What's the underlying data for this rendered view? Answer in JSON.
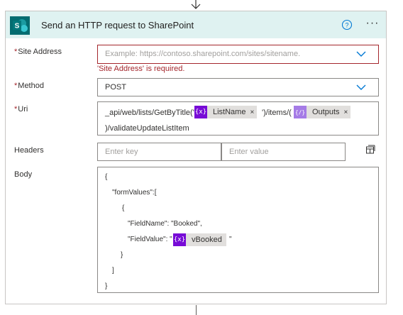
{
  "card": {
    "title": "Send an HTTP request to SharePoint",
    "help_icon": "question-circle-icon",
    "more_icon": "ellipsis-icon",
    "more_label": "···",
    "logo_letter": "S",
    "header_bg": "#dff2f1",
    "logo_color": "#038387"
  },
  "fields": {
    "required_mark": "*",
    "site_address": {
      "label": "Site Address",
      "placeholder": "Example: https://contoso.sharepoint.com/sites/sitename.",
      "error": "'Site Address' is required."
    },
    "method": {
      "label": "Method",
      "value": "POST"
    },
    "uri": {
      "label": "Uri",
      "text1": "_api/web/lists/GetByTitle('",
      "token1": "ListName",
      "text2": "')/items/(",
      "token2": "Outputs",
      "text3": ")/validateUpdateListItem"
    },
    "headers": {
      "label": "Headers",
      "key_placeholder": "Enter key",
      "value_placeholder": "Enter value"
    },
    "body": {
      "label": "Body",
      "lines": [
        "{",
        "\"formValues\":[",
        "{",
        "\"FieldName\": \"Booked\",",
        "\"FieldValue\": \"",
        "}",
        "]",
        "}"
      ],
      "token": "vBooked",
      "after_token": "\""
    }
  },
  "icons": {
    "expression": "{x}",
    "close": "×"
  },
  "colors": {
    "error": "#a4262c",
    "token_purple": "#770bd6",
    "token_lavender": "#a57be6",
    "chevron": "#0078d4"
  }
}
